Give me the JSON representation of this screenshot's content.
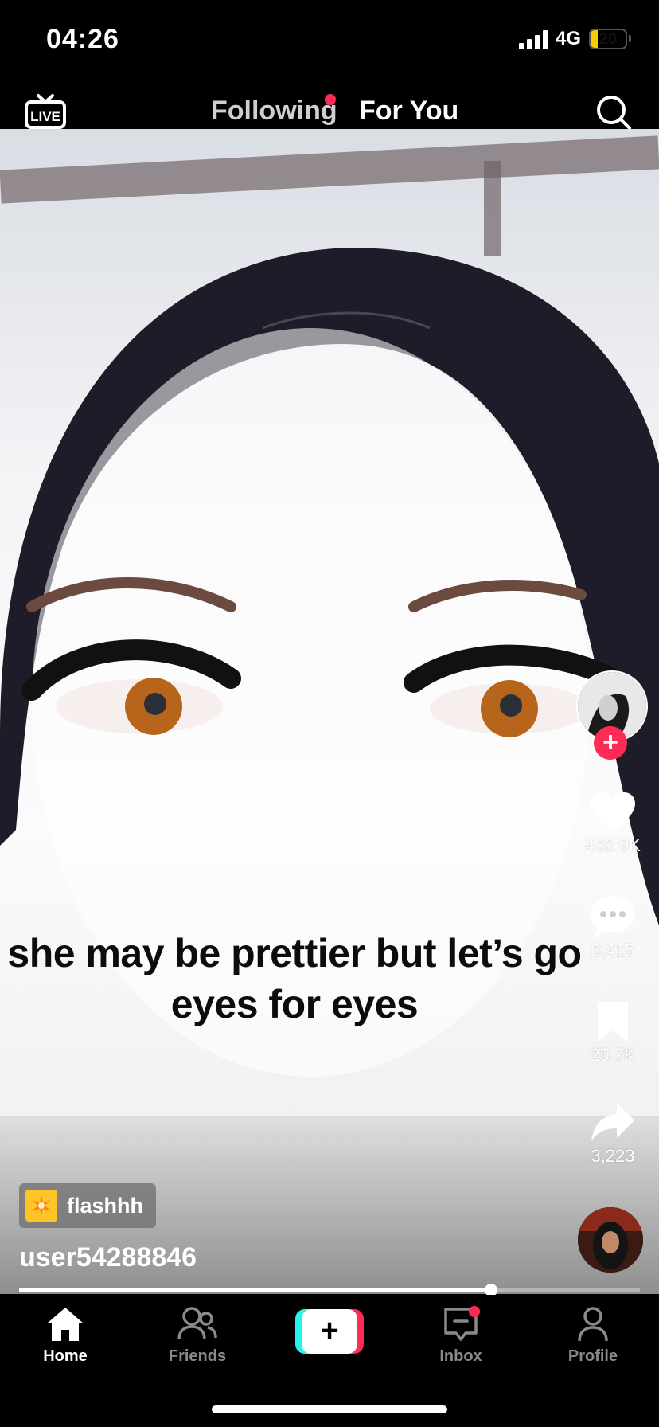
{
  "status": {
    "time": "04:26",
    "network": "4G",
    "battery": "20",
    "battery_level": 0.2
  },
  "top_nav": {
    "following": "Following",
    "for_you": "For You",
    "live_label": "LIVE"
  },
  "video": {
    "caption": "she may be prettier but let’s go eyes for eyes",
    "progress": 0.76
  },
  "actions": {
    "likes": "438.9K",
    "comments": "3,415",
    "saves": "25.7K",
    "shares": "3,223"
  },
  "post": {
    "sound": "flashhh",
    "username": "user54288846"
  },
  "bottom_nav": {
    "home": "Home",
    "friends": "Friends",
    "inbox": "Inbox",
    "profile": "Profile"
  },
  "colors": {
    "accent_red": "#fe2c55",
    "accent_cyan": "#25f4ee",
    "battery_yellow": "#f5d000"
  },
  "icons": [
    "live-tv-icon",
    "search-icon",
    "heart-icon",
    "comment-icon",
    "bookmark-icon",
    "share-icon",
    "home-icon",
    "friends-icon",
    "plus-icon",
    "inbox-icon",
    "profile-icon"
  ]
}
